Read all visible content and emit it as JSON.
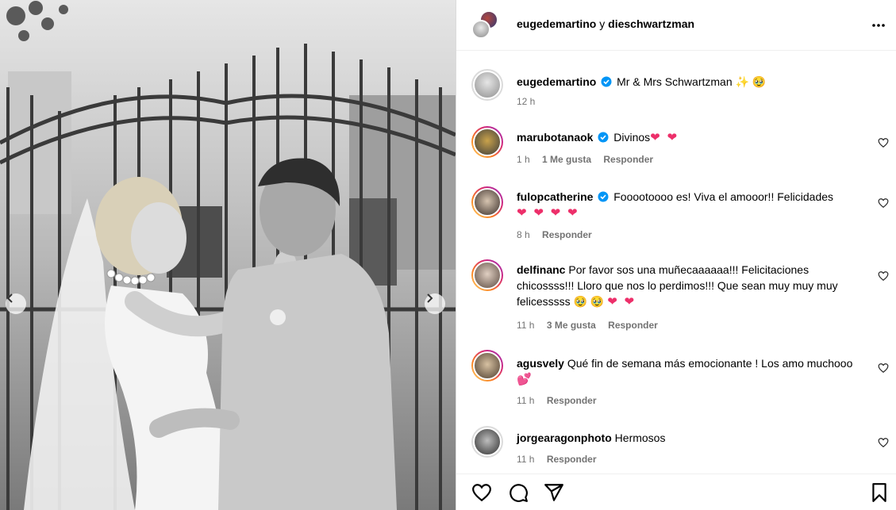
{
  "header": {
    "user1": "eugedemartino",
    "connector": " y ",
    "user2": "dieschwartzman"
  },
  "caption": {
    "user": "eugedemartino",
    "text": "Mr & Mrs Schwartzman ✨ 🥹",
    "time": "12 h"
  },
  "comments": [
    {
      "user": "marubotanaok",
      "verified": true,
      "text": "Divinos",
      "emoji": "❤ ❤",
      "time": "1 h",
      "likes": "1 Me gusta",
      "reply": "Responder"
    },
    {
      "user": "fulopcatherine",
      "verified": true,
      "text": "Fooootoooo es! Viva el amooor!! Felicidades",
      "emoji": "❤ ❤ ❤ ❤",
      "time": "8 h",
      "likes": "",
      "reply": "Responder"
    },
    {
      "user": "delfinanc",
      "verified": false,
      "text": "Por favor sos una muñecaaaaaa!!! Felicitaciones chicossss!!! Lloro que nos lo perdimos!!! Que sean muy muy muy felicesssss 🥹 🥹",
      "emoji": "❤ ❤",
      "time": "11 h",
      "likes": "3 Me gusta",
      "reply": "Responder"
    },
    {
      "user": "agusvely",
      "verified": false,
      "text": "Qué fin de semana más emocionante ! Los amo muchooo",
      "emoji": "💕",
      "time": "11 h",
      "likes": "",
      "reply": "Responder"
    },
    {
      "user": "jorgearagonphoto",
      "verified": false,
      "text": "Hermosos",
      "emoji": "",
      "time": "11 h",
      "likes": "",
      "reply": "Responder"
    }
  ],
  "icons": {
    "more": "more-horizontal-icon",
    "like": "heart-icon",
    "comment": "comment-icon",
    "share": "share-icon",
    "save": "bookmark-icon",
    "prev": "chevron-left-icon",
    "next": "chevron-right-icon",
    "verified": "verified-badge-icon"
  },
  "colors": {
    "verified": "#0095f6",
    "heart": "#ed2f6a",
    "secondary_text": "#737373"
  }
}
